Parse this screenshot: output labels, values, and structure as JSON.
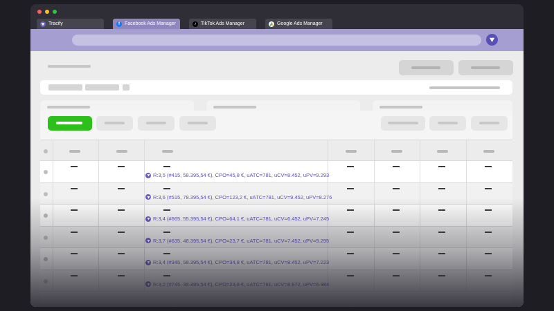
{
  "window": {
    "tabs": [
      {
        "label": "Tracify",
        "icon": "tracify-logo-icon"
      },
      {
        "label": "Facebook Ads Manager",
        "icon": "facebook-icon"
      },
      {
        "label": "TikTok Ads Manager",
        "icon": "tiktok-icon"
      },
      {
        "label": "Google Ads Manager",
        "icon": "google-ads-icon"
      }
    ],
    "active_tab": 1,
    "extension_icon": "tracify-logo-icon"
  },
  "colors": {
    "accent": "#6a5fc0",
    "toolbar": "#a59ed0",
    "primary_button": "#2ec01a",
    "attribution_text": "#5b4fc2"
  },
  "table": {
    "rows": [
      {
        "attribution": "R:3,5 (#415, 58.395,54 €), CPO=45,8 €, uATC=781, uCV=8.452, uPV=9.293"
      },
      {
        "attribution": "R:3,6 (#515, 78.395,54 €), CPO=123,2 €, uATC=781, uCV=9.452, uPV=8.276"
      },
      {
        "attribution": "R:3,4 (#665, 55.395,54 €), CPO=64,1 €, uATC=781, uCV=6.452, uPV=7.245"
      },
      {
        "attribution": "R:3,7 (#635, 48.395,54 €), CPO=23,7 €, uATC=781, uCV=7.452, uPV=9.295"
      },
      {
        "attribution": "R:3,4 (#345, 58.395,54 €), CPO=34,8 €, uATC=781, uCV=8.452, uPV=7.223"
      },
      {
        "attribution": "R:3,2 (#745, 38.395,54 €), CPO=23,8 €, uATC=781, uCV=8.672, uPV=6.984"
      }
    ]
  }
}
